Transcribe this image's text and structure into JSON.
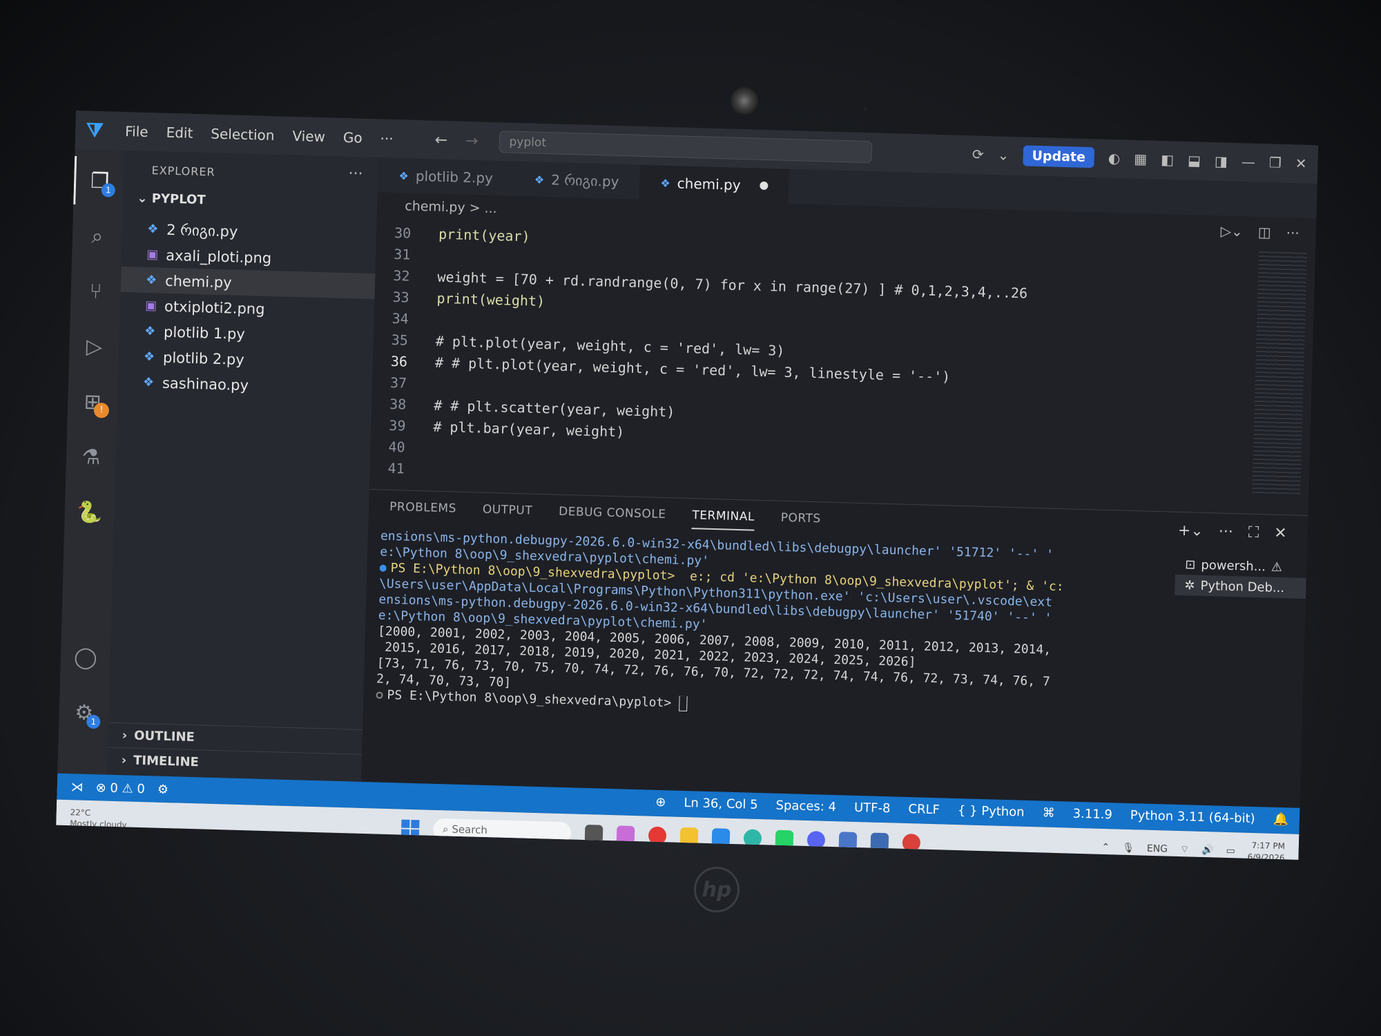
{
  "titlebar": {
    "menu": [
      "File",
      "Edit",
      "Selection",
      "View",
      "Go",
      "···"
    ],
    "search_text": "pyplot",
    "update_label": "Update"
  },
  "activity": {
    "explorer_badge": "1",
    "accounts_badge": "1"
  },
  "sidebar": {
    "title": "EXPLORER",
    "more": "···",
    "folder": "PYPLOT",
    "files": [
      {
        "name": "2 რიგი.py",
        "kind": "py"
      },
      {
        "name": "axali_ploti.png",
        "kind": "png"
      },
      {
        "name": "chemi.py",
        "kind": "py"
      },
      {
        "name": "otxiploti2.png",
        "kind": "png"
      },
      {
        "name": "plotlib 1.py",
        "kind": "py"
      },
      {
        "name": "plotlib 2.py",
        "kind": "py"
      },
      {
        "name": "sashinao.py",
        "kind": "py"
      }
    ],
    "outline": "OUTLINE",
    "timeline": "TIMELINE"
  },
  "tabs": [
    "plotlib 2.py",
    "2 რიგი.py",
    "chemi.py"
  ],
  "breadcrumb": "chemi.py > ...",
  "code": {
    "l30": "30",
    "l30_text": "print(year)",
    "l31": "31",
    "l32": "32",
    "l32_text": "weight = [70 + rd.randrange(0, 7) for x in range(27) ] # 0,1,2,3,4,..26",
    "l33": "33",
    "l33_text": "print(weight)",
    "l34": "34",
    "l35": "35",
    "l35_text": "# plt.plot(year, weight, c = 'red', lw= 3)",
    "l36": "36",
    "l36_text": "# # plt.plot(year, weight, c = 'red', lw= 3, linestyle = '--')",
    "l37": "37",
    "l38": "38",
    "l38_text": "# # plt.scatter(year, weight)",
    "l39": "39",
    "l39_text": "# plt.bar(year, weight)",
    "l40": "40",
    "l41": "41"
  },
  "panel": {
    "tabs": [
      "PROBLEMS",
      "OUTPUT",
      "DEBUG CONSOLE",
      "TERMINAL",
      "PORTS"
    ],
    "terminal_lines": [
      "ensions\\ms-python.debugpy-2026.6.0-win32-x64\\bundled\\libs\\debugpy\\launcher' '51712' '--' '",
      "e:\\Python 8\\oop\\9_shexvedra\\pyplot\\chemi.py'",
      "PS E:\\Python 8\\oop\\9_shexvedra\\pyplot>  e:; cd 'e:\\Python 8\\oop\\9_shexvedra\\pyplot'; & 'c:",
      "\\Users\\user\\AppData\\Local\\Programs\\Python\\Python311\\python.exe' 'c:\\Users\\user\\.vscode\\ext",
      "ensions\\ms-python.debugpy-2026.6.0-win32-x64\\bundled\\libs\\debugpy\\launcher' '51740' '--' '",
      "e:\\Python 8\\oop\\9_shexvedra\\pyplot\\chemi.py'",
      "[2000, 2001, 2002, 2003, 2004, 2005, 2006, 2007, 2008, 2009, 2010, 2011, 2012, 2013, 2014,",
      " 2015, 2016, 2017, 2018, 2019, 2020, 2021, 2022, 2023, 2024, 2025, 2026]",
      "[73, 71, 76, 73, 70, 75, 70, 74, 72, 76, 76, 70, 72, 72, 72, 74, 74, 76, 72, 73, 74, 76, 7",
      "2, 74, 70, 73, 70]",
      "PS E:\\Python 8\\oop\\9_shexvedra\\pyplot> "
    ],
    "terminals": [
      "powersh...",
      "Python Deb..."
    ]
  },
  "status": {
    "errors": "0",
    "warnings": "0",
    "position": "Ln 36, Col 5",
    "spaces": "Spaces: 4",
    "encoding": "UTF-8",
    "eol": "CRLF",
    "language": "Python",
    "py_version": "3.11.9",
    "interpreter": "Python 3.11 (64-bit)"
  },
  "taskbar": {
    "temp": "22°C",
    "weather": "Mostly cloudy",
    "search": "Search",
    "lang": "ENG",
    "time": "7:17 PM",
    "date": "6/9/2026"
  }
}
